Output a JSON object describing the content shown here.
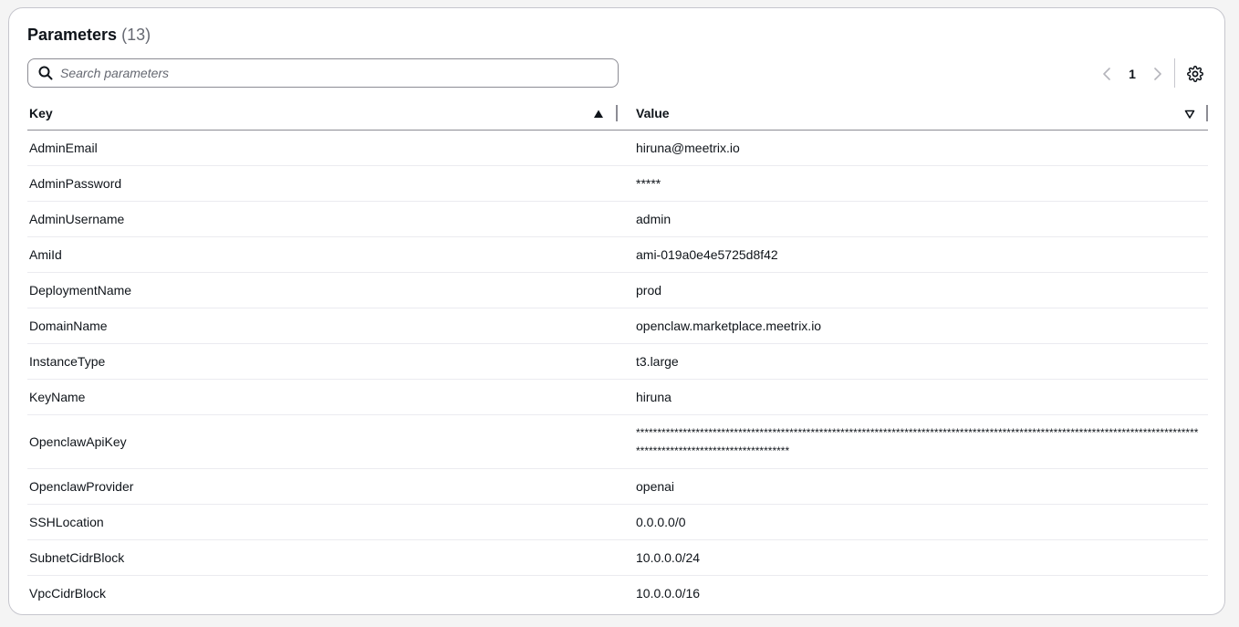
{
  "header": {
    "title": "Parameters",
    "count": "(13)"
  },
  "search": {
    "placeholder": "Search parameters",
    "value": ""
  },
  "pagination": {
    "current_page": "1"
  },
  "table": {
    "columns": {
      "key": "Key",
      "value": "Value"
    },
    "rows": [
      {
        "key": "AdminEmail",
        "value": "hiruna@meetrix.io"
      },
      {
        "key": "AdminPassword",
        "value": "*****"
      },
      {
        "key": "AdminUsername",
        "value": "admin"
      },
      {
        "key": "AmiId",
        "value": "ami-019a0e4e5725d8f42"
      },
      {
        "key": "DeploymentName",
        "value": "prod"
      },
      {
        "key": "DomainName",
        "value": "openclaw.marketplace.meetrix.io"
      },
      {
        "key": "InstanceType",
        "value": "t3.large"
      },
      {
        "key": "KeyName",
        "value": "hiruna"
      },
      {
        "key": "OpenclawApiKey",
        "value": "************************************************************************************************************************************************************************"
      },
      {
        "key": "OpenclawProvider",
        "value": "openai"
      },
      {
        "key": "SSHLocation",
        "value": "0.0.0.0/0"
      },
      {
        "key": "SubnetCidrBlock",
        "value": "10.0.0.0/24"
      },
      {
        "key": "VpcCidrBlock",
        "value": "10.0.0.0/16"
      }
    ]
  },
  "colors": {
    "text": "#0f141a",
    "muted": "#656871",
    "border": "#c6c6cd",
    "row_divider": "#ebebf0"
  },
  "icons": {
    "search": "search-icon",
    "prev": "chevron-left-icon",
    "next": "chevron-right-icon",
    "settings": "gear-icon",
    "sort_asc": "caret-up-filled-icon",
    "sort_none": "caret-down-outline-icon"
  }
}
